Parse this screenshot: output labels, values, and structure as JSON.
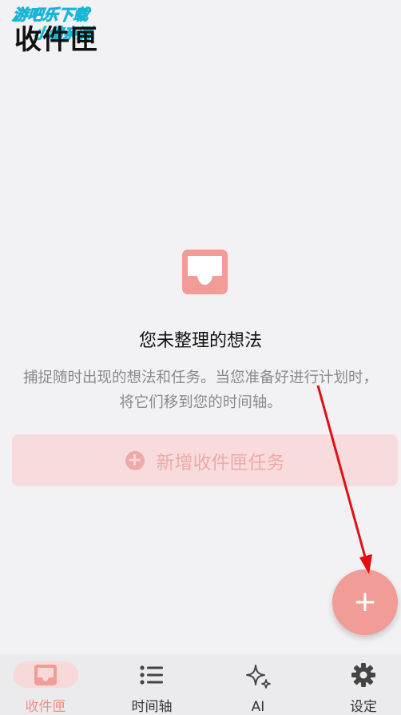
{
  "header": {
    "title": "收件匣",
    "watermark_line1": "游吧乐下载",
    "watermark_line2": "小编亲测"
  },
  "empty_state": {
    "icon": "inbox-icon",
    "title": "您未整理的想法",
    "description": "捕捉随时出现的想法和任务。当您准备好进行计划时，将它们移到您的时间轴。"
  },
  "add_task_button": {
    "label": "新增收件匣任务",
    "icon": "plus-circle-icon"
  },
  "fab": {
    "symbol": "+",
    "icon": "plus-icon"
  },
  "bottom_nav": {
    "items": [
      {
        "label": "收件匣",
        "icon": "inbox-icon",
        "active": true
      },
      {
        "label": "时间轴",
        "icon": "list-icon",
        "active": false
      },
      {
        "label": "AI",
        "icon": "sparkle-icon",
        "active": false
      },
      {
        "label": "设定",
        "icon": "gear-icon",
        "active": false
      }
    ]
  },
  "colors": {
    "accent": "#f19c96",
    "accent_light": "#f8dcdd",
    "background": "#f2f2f4",
    "annotation_arrow": "#e01010"
  }
}
